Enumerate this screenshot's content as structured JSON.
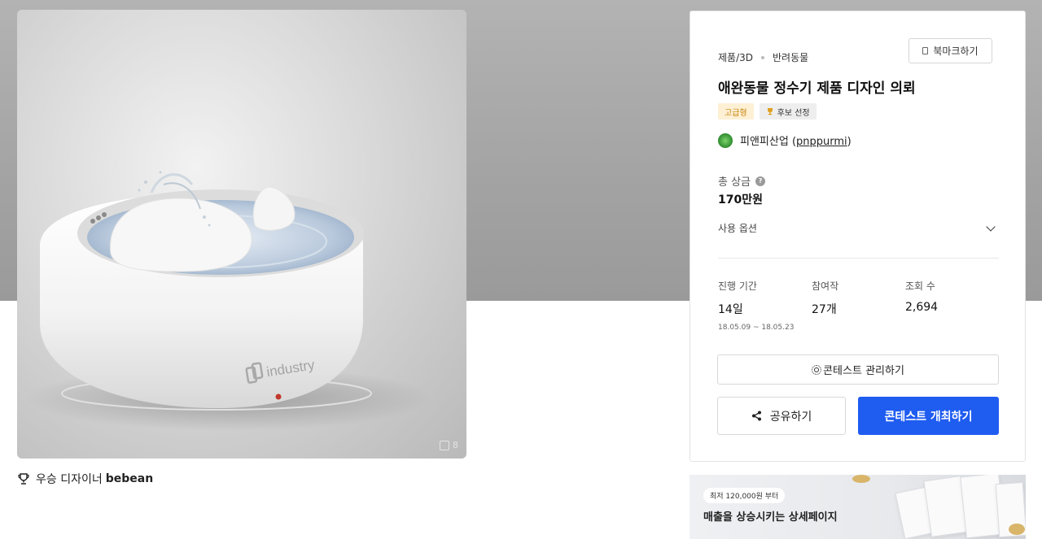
{
  "product": {
    "brand_text": "industry",
    "image_count": "8"
  },
  "winner": {
    "label": "우승 디자이너",
    "name": "bebean"
  },
  "contest": {
    "breadcrumb": [
      "제품/3D",
      "반려동물"
    ],
    "bookmark_label": "북마크하기",
    "title": "애완동물 정수기 제품 디자인 의뢰",
    "badges": [
      "고급형",
      "후보 선정"
    ],
    "organizer_name": "피앤피산업",
    "organizer_handle": "pnppurmi",
    "prize_label": "총 상금",
    "prize_help": "?",
    "prize_value": "170만원",
    "options_label": "사용 옵션",
    "stats": {
      "period_label": "진행 기간",
      "period_value": "14일",
      "period_range": "18.05.09 ~ 18.05.23",
      "entries_label": "참여작",
      "entries_value": "27개",
      "views_label": "조회 수",
      "views_value": "2,694"
    },
    "manage_button": "콘테스트 관리하기",
    "share_button": "공유하기",
    "host_button": "콘테스트 개최하기"
  },
  "ad": {
    "tag": "최저 120,000원 부터",
    "headline": "매출을 상승시키는 상세페이지"
  },
  "colors": {
    "primary": "#1f5cf0",
    "badge_gold_bg": "#fdf0d4",
    "badge_gold_text": "#c8850e"
  },
  "icons": [
    "trophy-icon",
    "bookmark-icon",
    "help-icon",
    "chevron-down-icon",
    "gear-icon",
    "share-icon",
    "image-count-icon"
  ]
}
